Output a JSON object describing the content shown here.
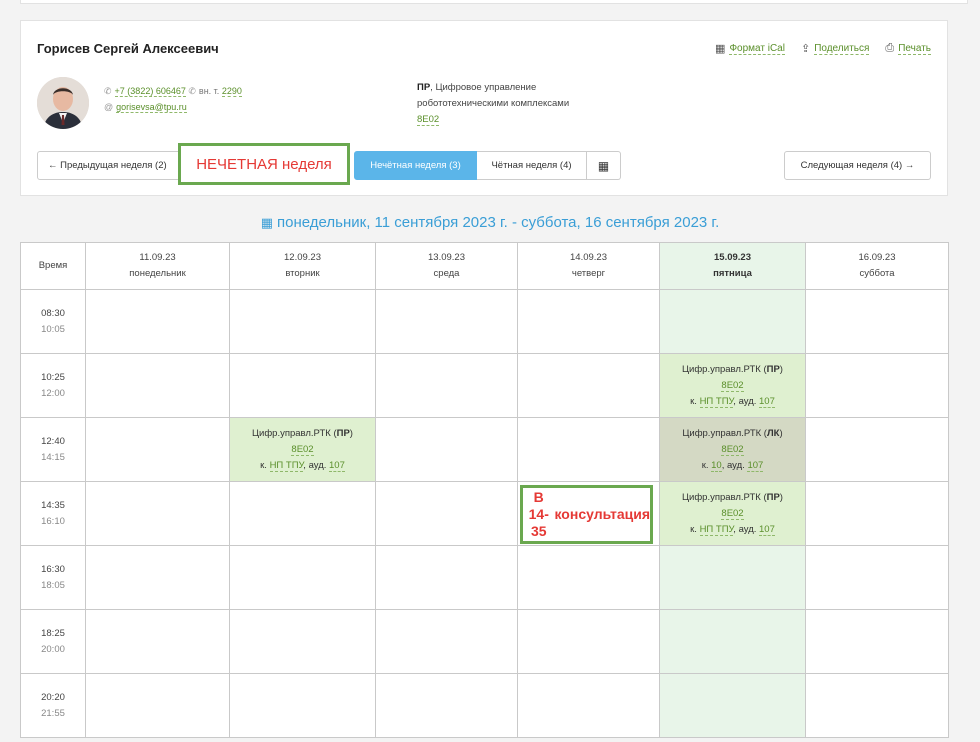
{
  "teacher": {
    "name": "Горисев Сергей Алексеевич",
    "phone": "+7 (3822) 606467",
    "ext_label": "вн. т.",
    "ext": "2290",
    "email": "gorisevsa@tpu.ru"
  },
  "actions": {
    "ical": "Формат iCal",
    "share": "Поделиться",
    "print": "Печать"
  },
  "dept": {
    "abbr": "ПР",
    "text": ", Цифровое управление робототехническими комплексами",
    "group": "8Е02"
  },
  "nav": {
    "prev": "← Предыдущая неделя (2)",
    "odd": "Нечётная неделя (3)",
    "even": "Чётная неделя (4)",
    "next": "Следующая неделя (4) →"
  },
  "annotations": {
    "odd_week": "НЕЧЕТНАЯ неделя",
    "consult_line1": "В 14-35",
    "consult_line2": "консультация"
  },
  "range": "понедельник, 11 сентября 2023 г. - суббота, 16 сентября 2023 г.",
  "schedule": {
    "time_header": "Время",
    "days": [
      {
        "date": "11.09.23",
        "name": "понедельник"
      },
      {
        "date": "12.09.23",
        "name": "вторник"
      },
      {
        "date": "13.09.23",
        "name": "среда"
      },
      {
        "date": "14.09.23",
        "name": "четверг"
      },
      {
        "date": "15.09.23",
        "name": "пятница"
      },
      {
        "date": "16.09.23",
        "name": "суббота"
      }
    ],
    "slots": [
      {
        "start": "08:30",
        "end": "10:05"
      },
      {
        "start": "10:25",
        "end": "12:00"
      },
      {
        "start": "12:40",
        "end": "14:15"
      },
      {
        "start": "14:35",
        "end": "16:10"
      },
      {
        "start": "16:30",
        "end": "18:05"
      },
      {
        "start": "18:25",
        "end": "20:00"
      },
      {
        "start": "20:20",
        "end": "21:55"
      }
    ],
    "lesson": {
      "subject": "Цифр.управл.РТК",
      "type_pr": "ПР",
      "type_lk": "ЛК",
      "group": "8Е02",
      "room_prefix": "к.",
      "building_np": "НП ТПУ",
      "building_10": "10",
      "room_label": "ауд.",
      "room": "107"
    }
  },
  "colors": {
    "accent": "#5bb5e9",
    "link": "#5a8f2a",
    "today_bg": "#e8f5e9",
    "lesson_bg": "#dff0d0",
    "lecture_bg": "#d4d9c4",
    "note_border": "#6aa84f",
    "note_text": "#e53935"
  }
}
